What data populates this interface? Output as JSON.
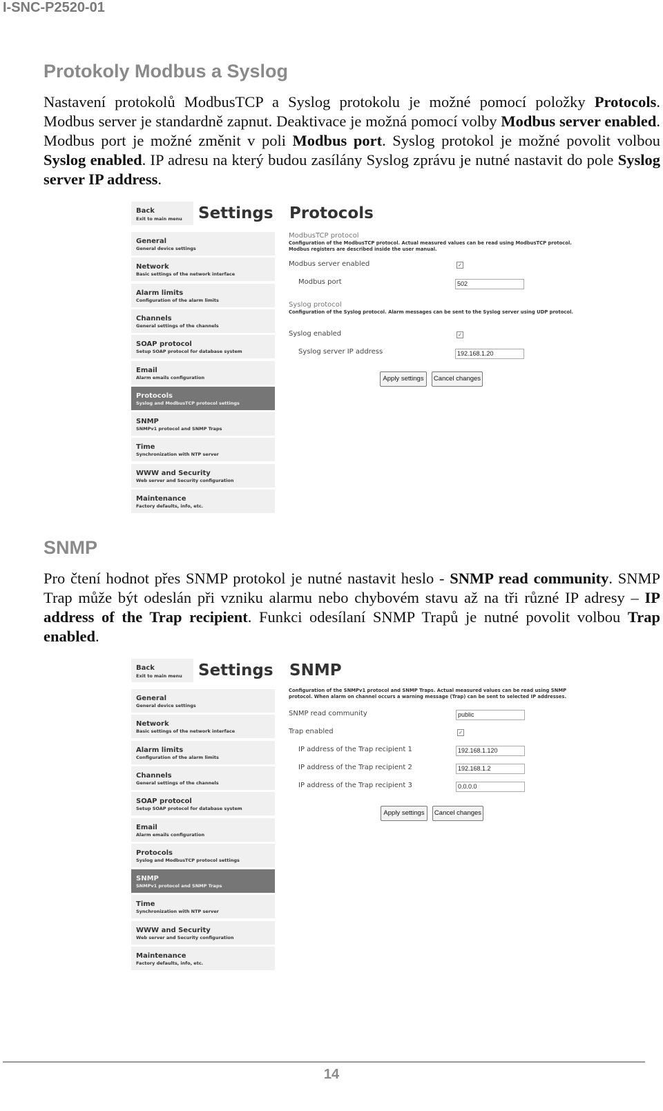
{
  "header": {
    "doc_id": "I-SNC-P2520-01"
  },
  "section1": {
    "heading": "Protokoly Modbus a Syslog",
    "paragraph": [
      {
        "t": "Nastavení protokolů ModbusTCP a Syslog protokolu je možné pomocí položky "
      },
      {
        "b": "Protocols"
      },
      {
        "t": ". Modbus server je standardně zapnut. Deaktivace je možná pomocí volby "
      },
      {
        "b": "Modbus server enabled"
      },
      {
        "t": ". Modbus port je možné změnit v poli "
      },
      {
        "b": "Modbus port"
      },
      {
        "t": ". Syslog protokol je možné povolit volbou "
      },
      {
        "b": "Syslog enabled"
      },
      {
        "t": ". IP adresu na který budou zasílány Syslog zprávu je nutné nastavit do pole "
      },
      {
        "b": "Syslog server IP address"
      },
      {
        "t": "."
      }
    ]
  },
  "section2": {
    "heading": "SNMP",
    "paragraph": [
      {
        "t": "Pro čtení hodnot přes SNMP protokol je nutné nastavit heslo - "
      },
      {
        "b": "SNMP read community"
      },
      {
        "t": ". SNMP Trap může být odeslán při vzniku alarmu nebo chybovém stavu až na tři různé IP adresy – "
      },
      {
        "b": "IP address of the Trap recipient"
      },
      {
        "t": ". Funkci odesílaní SNMP Trapů je nutné povolit volbou "
      },
      {
        "b": "Trap enabled"
      },
      {
        "t": "."
      }
    ]
  },
  "sidebar": {
    "back_title": "Back",
    "back_sub": "Exit to main menu",
    "settings_title": "Settings",
    "items": [
      {
        "title": "General",
        "sub": "General device settings"
      },
      {
        "title": "Network",
        "sub": "Basic settings of the network interface"
      },
      {
        "title": "Alarm limits",
        "sub": "Configuration of the alarm limits"
      },
      {
        "title": "Channels",
        "sub": "General settings of the channels"
      },
      {
        "title": "SOAP protocol",
        "sub": "Setup SOAP protocol for database system"
      },
      {
        "title": "Email",
        "sub": "Alarm emails configuration"
      },
      {
        "title": "Protocols",
        "sub": "Syslog and ModbusTCP protocol settings"
      },
      {
        "title": "SNMP",
        "sub": "SNMPv1 protocol and SNMP Traps"
      },
      {
        "title": "Time",
        "sub": "Synchronization with NTP server"
      },
      {
        "title": "WWW and Security",
        "sub": "Web server and Security configuration"
      },
      {
        "title": "Maintenance",
        "sub": "Factory defaults, info, etc."
      }
    ]
  },
  "shot1": {
    "page_title": "Protocols",
    "active_item": "Protocols",
    "modbus": {
      "title": "ModbusTCP protocol",
      "desc": "Configuration of the ModbusTCP protocol. Actual measured values can be read using ModbusTCP protocol. Modbus registers are described inside the user manual.",
      "enabled_label": "Modbus server enabled",
      "enabled_mark": "✓",
      "port_label": "Modbus port",
      "port_value": "502"
    },
    "syslog": {
      "title": "Syslog protocol",
      "desc": "Configuration of the Syslog protocol. Alarm messages can be sent to the Syslog server using UDP protocol.",
      "enabled_label": "Syslog enabled",
      "enabled_mark": "✓",
      "ip_label": "Syslog server IP address",
      "ip_value": "192.168.1.20"
    },
    "apply_label": "Apply settings",
    "cancel_label": "Cancel changes"
  },
  "shot2": {
    "page_title": "SNMP",
    "active_item": "SNMP",
    "desc": "Configuration of the SNMPv1 protocol and SNMP Traps. Actual measured values can be read using SNMP protocol. When alarm on channel occurs a warning message (Trap) can be sent to selected IP addresses.",
    "community_label": "SNMP read community",
    "community_value": "public",
    "trap_enabled_label": "Trap enabled",
    "trap_enabled_mark": "✓",
    "recipients": [
      {
        "label": "IP address of the Trap recipient 1",
        "value": "192.168.1.120"
      },
      {
        "label": "IP address of the Trap recipient 2",
        "value": "192.168.1.2"
      },
      {
        "label": "IP address of the Trap recipient 3",
        "value": "0.0.0.0"
      }
    ],
    "apply_label": "Apply settings",
    "cancel_label": "Cancel changes"
  },
  "footer": {
    "page_number": "14"
  }
}
